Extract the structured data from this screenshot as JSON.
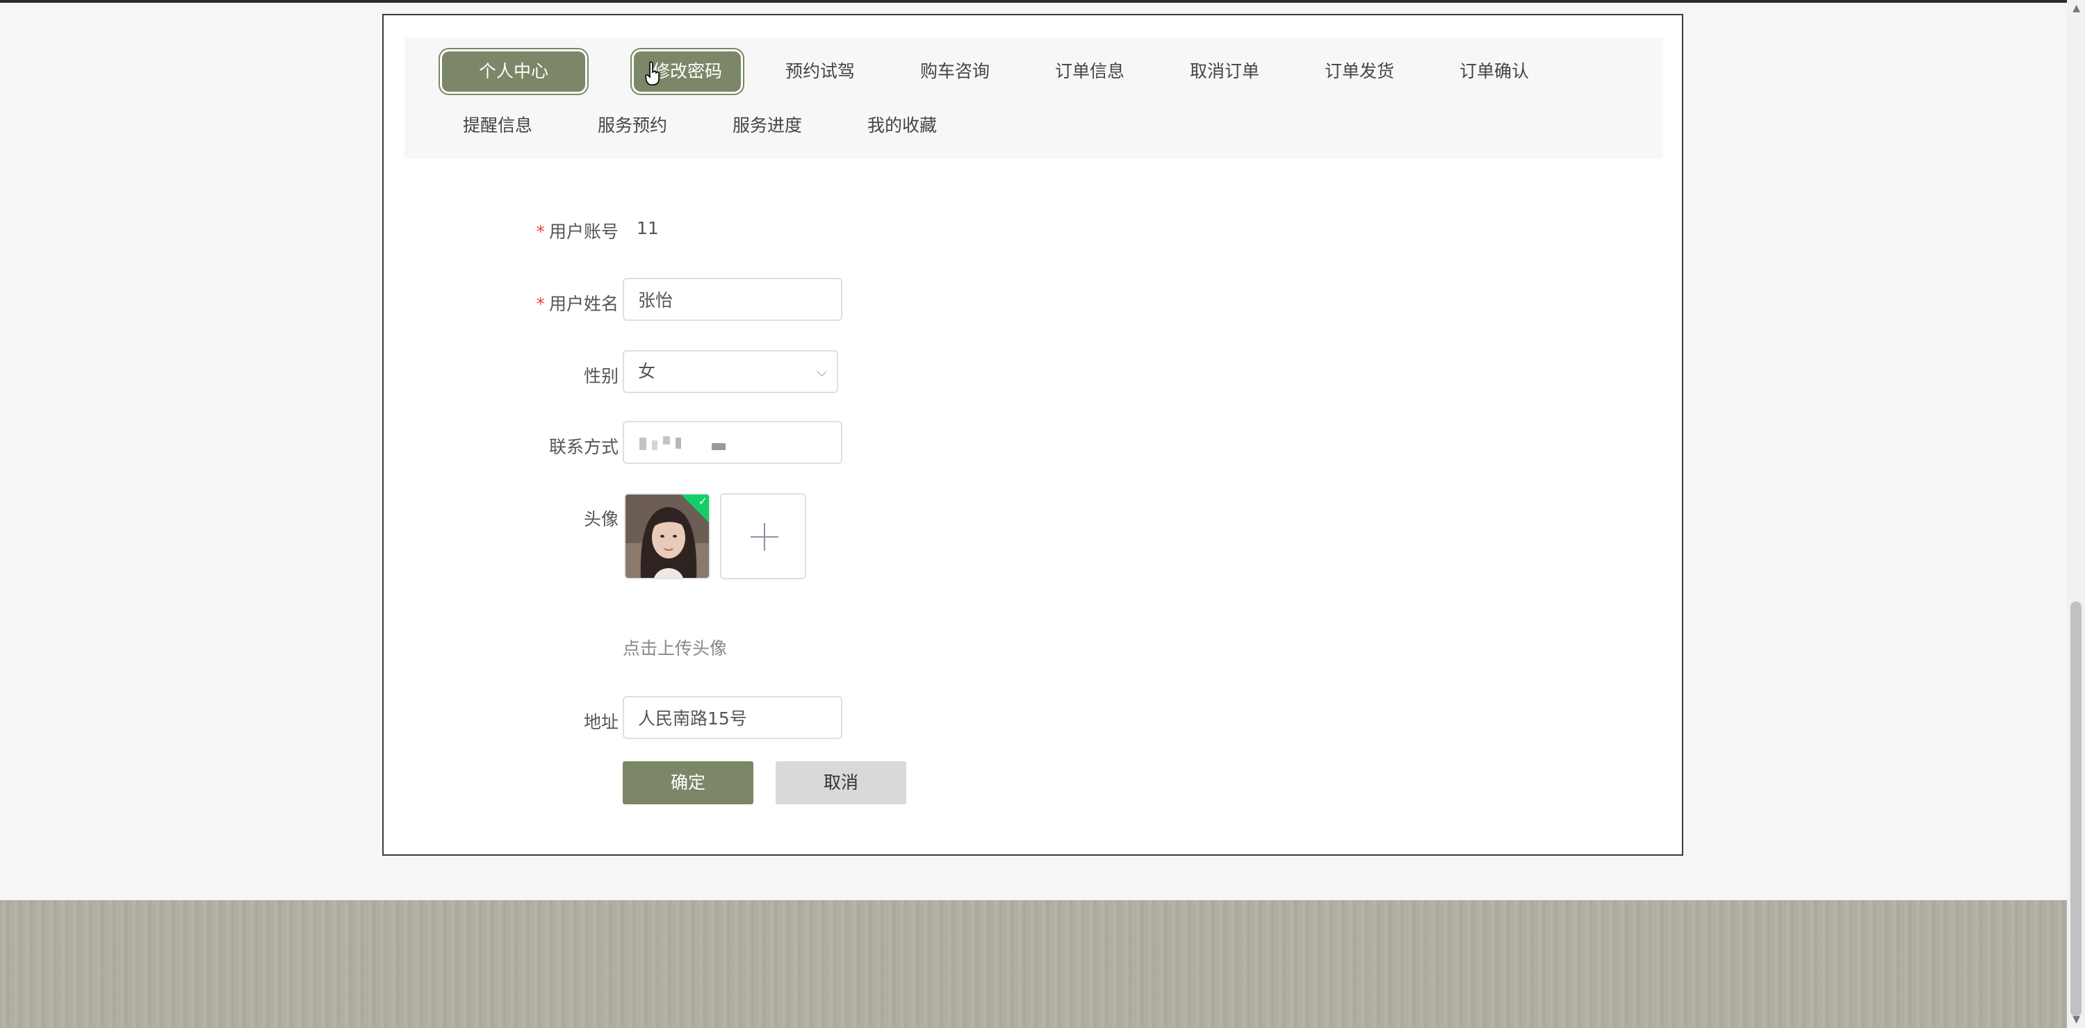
{
  "tabs": {
    "row1": [
      "个人中心",
      "修改密码",
      "预约试驾",
      "购车咨询",
      "订单信息",
      "取消订单",
      "订单发货",
      "订单确认"
    ],
    "row2": [
      "提醒信息",
      "服务预约",
      "服务进度",
      "我的收藏"
    ]
  },
  "form": {
    "account": {
      "label": "用户账号",
      "value": "11"
    },
    "name": {
      "label": "用户姓名",
      "value": "张怡"
    },
    "gender": {
      "label": "性别",
      "value": "女"
    },
    "contact": {
      "label": "联系方式"
    },
    "avatar": {
      "label": "头像",
      "hint": "点击上传头像"
    },
    "address": {
      "label": "地址",
      "value": "人民南路15号"
    },
    "required_mark": "*"
  },
  "buttons": {
    "confirm": "确定",
    "cancel": "取消"
  },
  "colors": {
    "accent": "#7b8767",
    "success": "#13ce66",
    "required": "#e24848"
  }
}
